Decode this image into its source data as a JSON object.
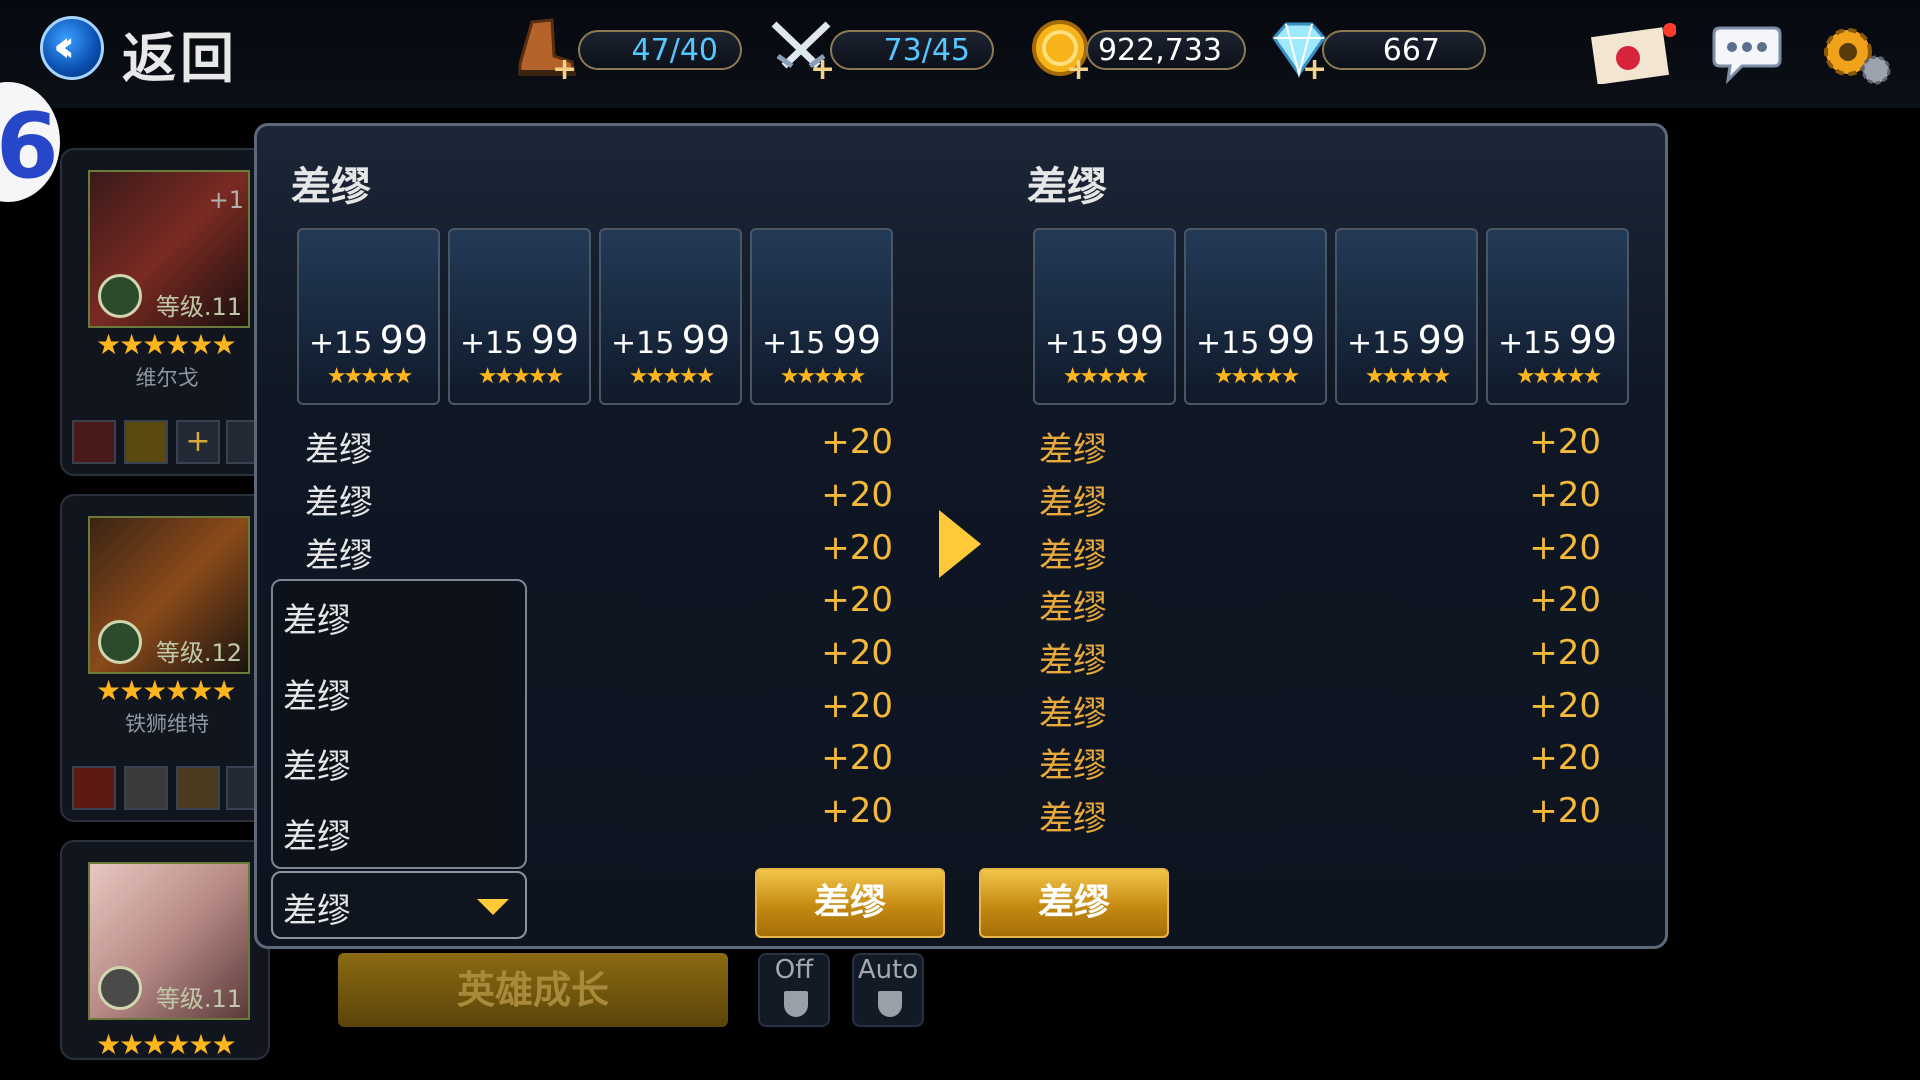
{
  "topbar": {
    "back_label": "返回",
    "stamina": "47/40",
    "swords": "73/45",
    "gold": "922,733",
    "gems": "667",
    "icons": [
      "boot-icon",
      "crossed-swords-icon",
      "gold-coin-icon",
      "diamond-icon",
      "mail-icon",
      "chat-icon",
      "settings-gear-icon"
    ]
  },
  "left_list": {
    "heroes": [
      {
        "name": "维尔戈",
        "level": "等级.11",
        "plus": "+1",
        "stars": "★★★★★★"
      },
      {
        "name": "铁狮维特",
        "level": "等级.12",
        "stars": "★★★★★★"
      },
      {
        "level": "等级.11",
        "stars": "★★★★★★"
      }
    ]
  },
  "panel": {
    "left_title": "差缪",
    "right_title": "差缪",
    "left_cards": [
      {
        "enh": "+15",
        "lvl": "99",
        "stars": "★★★★★"
      },
      {
        "enh": "+15",
        "lvl": "99",
        "stars": "★★★★★"
      },
      {
        "enh": "+15",
        "lvl": "99",
        "stars": "★★★★★"
      },
      {
        "enh": "+15",
        "lvl": "99",
        "stars": "★★★★★"
      }
    ],
    "right_cards": [
      {
        "enh": "+15",
        "lvl": "99",
        "stars": "★★★★★"
      },
      {
        "enh": "+15",
        "lvl": "99",
        "stars": "★★★★★"
      },
      {
        "enh": "+15",
        "lvl": "99",
        "stars": "★★★★★"
      },
      {
        "enh": "+15",
        "lvl": "99",
        "stars": "★★★★★"
      }
    ],
    "left_stats": [
      {
        "label": "差缪",
        "value": "+20"
      },
      {
        "label": "差缪",
        "value": "+20"
      },
      {
        "label": "差缪",
        "value": "+20"
      },
      {
        "label": "",
        "value": "+20"
      },
      {
        "label": "",
        "value": "+20"
      },
      {
        "label": "",
        "value": "+20"
      },
      {
        "label": "",
        "value": "+20"
      },
      {
        "label": "",
        "value": "+20"
      }
    ],
    "right_stats": [
      {
        "label": "差缪",
        "value": "+20"
      },
      {
        "label": "差缪",
        "value": "+20"
      },
      {
        "label": "差缪",
        "value": "+20"
      },
      {
        "label": "差缪",
        "value": "+20"
      },
      {
        "label": "差缪",
        "value": "+20"
      },
      {
        "label": "差缪",
        "value": "+20"
      },
      {
        "label": "差缪",
        "value": "+20"
      },
      {
        "label": "差缪",
        "value": "+20"
      }
    ],
    "dropdown": {
      "options": [
        "差缪",
        "差缪",
        "差缪",
        "差缪"
      ],
      "selected": "差缪"
    },
    "button_1": "差缪",
    "button_2": "差缪"
  },
  "bottom": {
    "grow_label": "英雄成长",
    "off_label": "Off",
    "auto_label": "Auto"
  },
  "colors": {
    "accent_gold": "#f4b93a",
    "star": "#ffb61e",
    "panel_border": "#5d6878"
  }
}
